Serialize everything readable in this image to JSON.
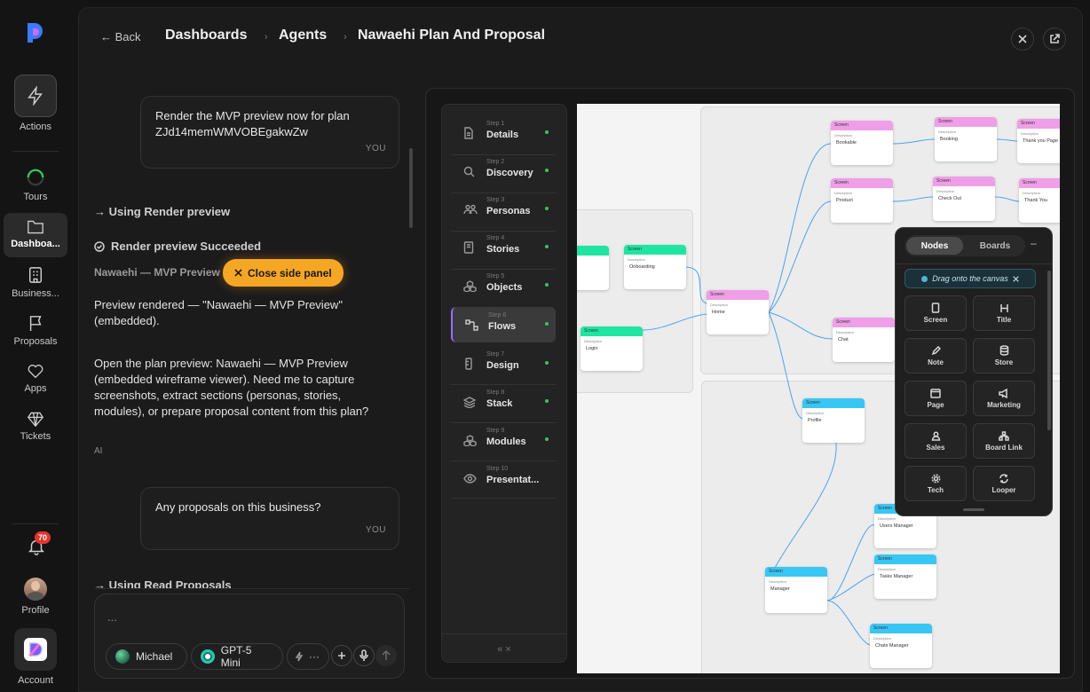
{
  "rail": {
    "actions": "Actions",
    "tours": "Tours",
    "dashboards": "Dashboa...",
    "business": "Business...",
    "proposals": "Proposals",
    "apps": "Apps",
    "tickets": "Tickets",
    "notifications_count": "70",
    "profile": "Profile",
    "account": "Account"
  },
  "header": {
    "back": "← Back",
    "crumbs": [
      "Dashboards",
      "Agents",
      "Nawaehi Plan And Proposal"
    ],
    "separator": "›"
  },
  "chat": {
    "user_msg_1": {
      "text": "Render the MVP preview now for plan ZJd14memWMVOBEgakwZw",
      "who": "YOU"
    },
    "tool_1": "→ Using Render preview",
    "status_1": "Render preview Succeeded",
    "subtitle": "Nawaehi — MVP Preview",
    "close_panel": "Close side panel",
    "ai_para_1": "Preview rendered — \"Nawaehi — MVP Preview\" (embedded).",
    "ai_para_2": "Open the plan preview: Nawaehi — MVP Preview (embedded wireframe viewer). Need me to capture screenshots, extract sections (personas, stories, modules), or prepare proposal content from this plan?",
    "ai_label": "AI",
    "user_msg_2": {
      "text": "Any proposals on this business?",
      "who": "YOU"
    },
    "tool_2": "→ Using Read Proposals"
  },
  "composer": {
    "placeholder": "...",
    "user_pill": "Michael",
    "model_pill": "GPT-5 Mini",
    "more": "···"
  },
  "steps": [
    {
      "num": "Step 1",
      "title": "Details",
      "icon": "document-icon"
    },
    {
      "num": "Step 2",
      "title": "Discovery",
      "icon": "search-icon"
    },
    {
      "num": "Step 3",
      "title": "Personas",
      "icon": "users-icon"
    },
    {
      "num": "Step 4",
      "title": "Stories",
      "icon": "book-icon"
    },
    {
      "num": "Step 5",
      "title": "Objects",
      "icon": "cubes-icon"
    },
    {
      "num": "Step 6",
      "title": "Flows",
      "icon": "flow-icon"
    },
    {
      "num": "Step 7",
      "title": "Design",
      "icon": "design-icon"
    },
    {
      "num": "Step 8",
      "title": "Stack",
      "icon": "stack-icon"
    },
    {
      "num": "Step 9",
      "title": "Modules",
      "icon": "modules-icon"
    },
    {
      "num": "Step 10",
      "title": "Presentat...",
      "icon": "eye-icon"
    }
  ],
  "steps_footer": "«  ×",
  "canvas": {
    "node_header": "Screen",
    "node_desc": "Description",
    "nodes": [
      "Bookable",
      "Booking",
      "Thank you Page",
      "Product",
      "Check Out",
      "Thank You",
      "Onboarding",
      "Home",
      "Login",
      "Chat",
      "Profile",
      "Users Manager",
      "Tasks Manager",
      "Manager",
      "Chats Manager"
    ]
  },
  "palette": {
    "tab_nodes": "Nodes",
    "tab_boards": "Boards",
    "minimize": "–",
    "hint": "Drag onto the canvas",
    "tiles": [
      "Screen",
      "Title",
      "Note",
      "Store",
      "Page",
      "Marketing",
      "Sales",
      "Board Link",
      "Tech",
      "Looper"
    ]
  }
}
